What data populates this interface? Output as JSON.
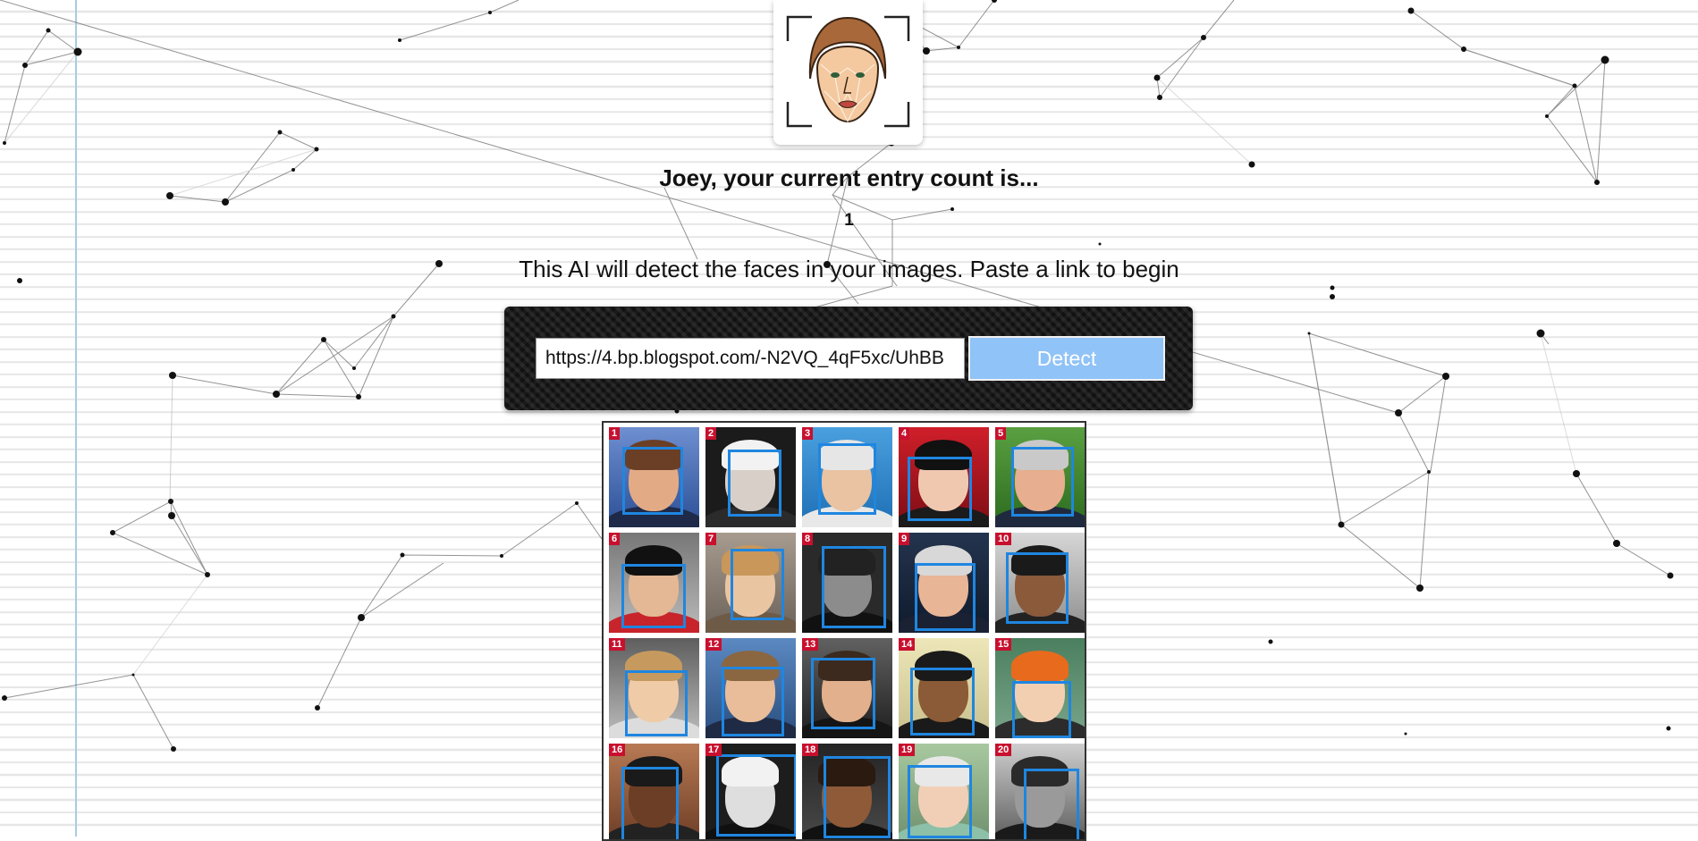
{
  "header": {
    "entry_title": "Joey, your current entry count is...",
    "entry_count": "1",
    "instructions": "This AI will detect the faces in your images. Paste a link to begin"
  },
  "logo": {
    "icon": "face-scan-icon"
  },
  "form": {
    "url_value": "https://4.bp.blogspot.com/-N2VQ_4qF5xc/UhBB",
    "detect_label": "Detect"
  },
  "result": {
    "tiles": [
      {
        "num": "1"
      },
      {
        "num": "2"
      },
      {
        "num": "3"
      },
      {
        "num": "4"
      },
      {
        "num": "5"
      },
      {
        "num": "6"
      },
      {
        "num": "7"
      },
      {
        "num": "8"
      },
      {
        "num": "9"
      },
      {
        "num": "10"
      },
      {
        "num": "11"
      },
      {
        "num": "12"
      },
      {
        "num": "13"
      },
      {
        "num": "14"
      },
      {
        "num": "15"
      },
      {
        "num": "16"
      },
      {
        "num": "17"
      },
      {
        "num": "18"
      },
      {
        "num": "19"
      },
      {
        "num": "20"
      }
    ]
  },
  "colors": {
    "detect_button": "#90c3f7",
    "detection_box": "#1f86e0",
    "tile_number_badge": "#c8102e"
  }
}
